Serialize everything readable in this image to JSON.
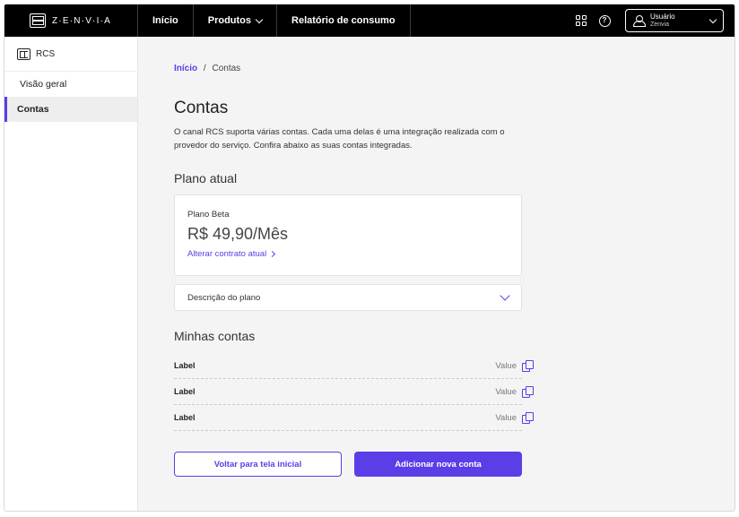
{
  "brand": {
    "name": "Z·E·N·V·I·A"
  },
  "topnav": {
    "items": [
      {
        "label": "Início"
      },
      {
        "label": "Produtos"
      },
      {
        "label": "Relatório de consumo"
      }
    ],
    "user": {
      "name": "Usuário",
      "org": "Zenvia"
    }
  },
  "sidebar": {
    "header": "RCS",
    "items": [
      {
        "label": "Visão geral",
        "active": false
      },
      {
        "label": "Contas",
        "active": true
      }
    ]
  },
  "breadcrumb": {
    "home": "Início",
    "separator": "/",
    "current": "Contas"
  },
  "page": {
    "title": "Contas",
    "description": "O canal RCS suporta várias contas. Cada uma delas é uma integração realizada com o provedor do serviço. Confira abaixo as suas contas integradas."
  },
  "plan": {
    "section_title": "Plano atual",
    "name": "Plano Beta",
    "price": "R$ 49,90/Mês",
    "change_link": "Alterar contrato atual",
    "accordion_label": "Descrição do plano"
  },
  "accounts": {
    "section_title": "Minhas contas",
    "rows": [
      {
        "label": "Label",
        "value": "Value"
      },
      {
        "label": "Label",
        "value": "Value"
      },
      {
        "label": "Label",
        "value": "Value"
      }
    ]
  },
  "actions": {
    "back_label": "Voltar para tela inicial",
    "add_label": "Adicionar nova conta"
  },
  "colors": {
    "accent": "#5b3ee6",
    "topbar": "#000000",
    "background": "#f4f4f4"
  },
  "icons": [
    "zenvia-logo-icon",
    "apps-grid-icon",
    "help-icon",
    "user-icon",
    "chevron-down-icon",
    "rcs-icon",
    "chevron-right-icon",
    "copy-icon"
  ]
}
